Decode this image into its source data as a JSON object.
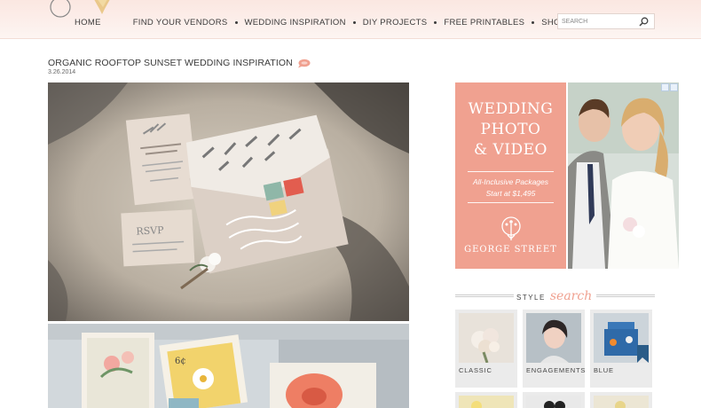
{
  "nav": {
    "home": "HOME",
    "items": [
      "FIND YOUR VENDORS",
      "WEDDING INSPIRATION",
      "DIY PROJECTS",
      "FREE PRINTABLES",
      "SHOP"
    ]
  },
  "search": {
    "placeholder": "SEARCH"
  },
  "post": {
    "title": "ORGANIC ROOFTOP SUNSET WEDDING INSPIRATION",
    "date": "3.26.2014"
  },
  "ad": {
    "line1": "WEDDING",
    "line2": "PHOTO",
    "line3": "& VIDEO",
    "sub1": "All-Inclusive Packages",
    "sub2": "Start at $1,495",
    "brand": "GEORGE STREET"
  },
  "style_search": {
    "label": "STYLE",
    "script": "search",
    "tiles": [
      {
        "label": "CLASSIC"
      },
      {
        "label": "ENGAGEMENTS"
      },
      {
        "label": "BLUE"
      }
    ]
  },
  "colors": {
    "accent": "#f0a190",
    "header_bg": "#fbe7e1",
    "tile_bg": "#ebebeb"
  },
  "icons": {
    "search": "magnifier-icon",
    "comment": "speech-bubble-icon"
  }
}
